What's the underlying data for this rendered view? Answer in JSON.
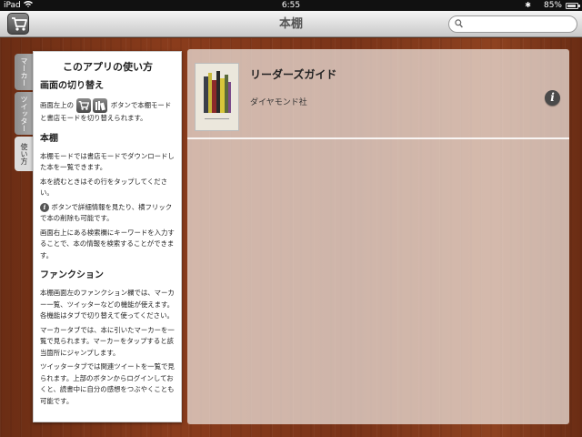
{
  "status_bar": {
    "carrier": "iPad",
    "time": "6:55",
    "battery": "85%",
    "battery_level": 0.85
  },
  "nav": {
    "title": "本棚",
    "search_placeholder": ""
  },
  "side_tabs": [
    {
      "label": "マーカー",
      "active": false
    },
    {
      "label": "ツイッター",
      "active": false
    },
    {
      "label": "使い方",
      "active": true
    }
  ],
  "help": {
    "title": "このアプリの使い方",
    "section1_heading": "画面の切り替え",
    "section1_pre": "画面左上の",
    "section1_post": "ボタンで本棚モードと書店モードを切り替えられます。",
    "section2_heading": "本棚",
    "section2_p1": "本棚モードでは書店モードでダウンロードした本を一覧できます。",
    "section2_p2": "本を読むときはその行をタップしてください。",
    "section2_p3": "ボタンで詳細情報を見たり、横フリックで本の削除も可能です。",
    "section2_p4": "画面右上にある検索欄にキーワードを入力することで、本の情報を検索することができます。",
    "section3_heading": "ファンクション",
    "section3_p1": "本棚画面左のファンクション欄では、マーカー一覧、ツイッターなどの機能が使えます。各機能はタブで切り替えて使ってください。",
    "section3_p2": "マーカータブでは、本に引いたマーカーを一覧で見られます。マーカーをタップすると該当箇所にジャンプします。",
    "section3_p3": "ツイッタータブでは関連ツイートを一覧で見られます。上部のボタンからログインしておくと、読書中に自分の感想をつぶやくことも可能です。"
  },
  "books": [
    {
      "title": "リーダーズガイド",
      "publisher": "ダイヤモンド社"
    }
  ]
}
